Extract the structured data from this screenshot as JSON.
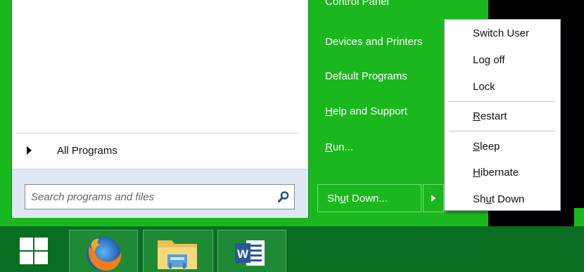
{
  "colors": {
    "shell_green": "#1ab81e",
    "taskbar_green": "#0a6e22",
    "left_bottom": "#dfe9f3"
  },
  "left_pane": {
    "all_programs": "All Programs",
    "search_placeholder": "Search programs and files",
    "icons": {
      "arrow": "triangle-right-icon",
      "search": "search-icon"
    }
  },
  "right_pane": {
    "control_panel": "Control Panel",
    "devices": "Devices and Printers",
    "default_programs": "Default Programs",
    "help_pre": "",
    "help_ul": "H",
    "help_post": "elp and Support",
    "run_ul": "R",
    "run_post": "un...",
    "shutdown_pre": "Sh",
    "shutdown_ul": "u",
    "shutdown_post": "t Down..."
  },
  "popup_menu": {
    "switch_user": "Switch User",
    "log_off": "Log off",
    "lock": "Lock",
    "restart_ul": "R",
    "restart_post": "estart",
    "sleep_ul": "S",
    "sleep_post": "leep",
    "hibernate_ul": "H",
    "hibernate_post": "ibernate",
    "shutdown_pre": "Sh",
    "shutdown_ul": "u",
    "shutdown_post": "t Down"
  },
  "taskbar": {
    "icons": [
      "windows-logo-icon",
      "firefox-icon",
      "file-explorer-icon",
      "word-icon"
    ],
    "word_letter": "W"
  }
}
